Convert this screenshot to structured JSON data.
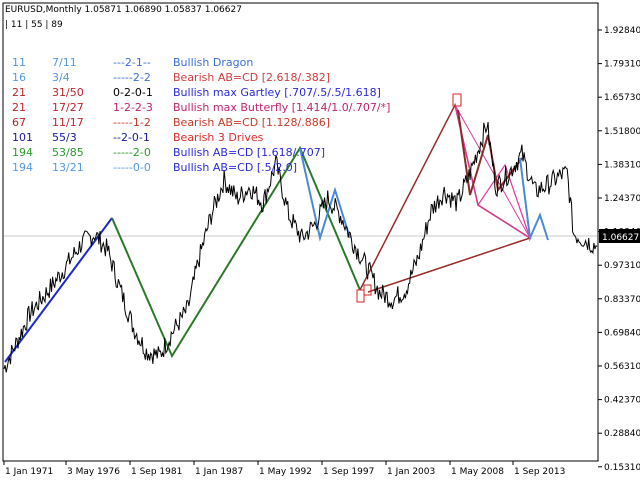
{
  "header": {
    "symbol_line": "EURUSD,Monthly  1.05871 1.06890 1.05837 1.06627",
    "fib_line": "| 11 | 55 | 89"
  },
  "patterns": [
    {
      "period": "11",
      "ratio": "7/11",
      "code": "---2-1--",
      "name": "Bullish Dragon",
      "color": "#3a6fd8"
    },
    {
      "period": "16",
      "ratio": "3/4",
      "code": "-----2-2",
      "name": "Bearish AB=CD [2.618/.382]",
      "color": "#d23c3c"
    },
    {
      "period": "21",
      "ratio": "31/50",
      "code": "0-2-0-1",
      "name": "Bullish max Gartley [.707/.5/.5/1.618]",
      "color": "#2a2adc"
    },
    {
      "period": "21",
      "ratio": "17/27",
      "code": "1-2-2-3",
      "name": "Bullish max Butterfly [1.414/1.0/.707/*]",
      "color": "#c0226e"
    },
    {
      "period": "67",
      "ratio": "11/17",
      "code": "-----1-2",
      "name": "Bearish AB=CD [1.128/.886]",
      "color": "#c83a2a"
    },
    {
      "period": "101",
      "ratio": "55/3",
      "code": "--2-0-1",
      "name": "Bearish 3 Drives",
      "color": "#e02a2a"
    },
    {
      "period": "194",
      "ratio": "53/85",
      "code": "-----2-0",
      "name": "Bullish AB=CD [1.618/.707]",
      "color": "#2a2adc"
    },
    {
      "period": "194",
      "ratio": "13/21",
      "code": "-----0-0",
      "name": "Bullish AB=CD [.5/2.0]",
      "color": "#2a2adc"
    }
  ],
  "period_colors": [
    "#5599dd",
    "#5599dd",
    "#c0222a",
    "#c0222a",
    "#c0222a",
    "#1a1a9a",
    "#2a9a2a",
    "#5599dd"
  ],
  "ratio_colors": [
    "#5599dd",
    "#5599dd",
    "#c0222a",
    "#c0222a",
    "#c0222a",
    "#1a1a9a",
    "#2a9a2a",
    "#5599dd"
  ],
  "code_colors": [
    "#3a6fd8",
    "#3a6fd8",
    "#000000",
    "#c0226e",
    "#c83a2a",
    "#1a1a9a",
    "#2a9a2a",
    "#5599dd"
  ],
  "chart_data": {
    "type": "line",
    "symbol": "EURUSD",
    "timeframe": "Monthly",
    "current_price": "1.06627",
    "ylim": [
      0.156,
      2.1
    ],
    "y_ticks": [
      "1.92840",
      "1.79310",
      "1.65730",
      "1.51800",
      "1.38310",
      "1.24370",
      "1.10840",
      "0.97310",
      "0.83370",
      "0.69840",
      "0.56310",
      "0.42370",
      "0.28840",
      "0.15310"
    ],
    "x_ticks": [
      "1 Jan 1971",
      "3 May 1976",
      "1 Sep 1981",
      "1 Jan 1987",
      "1 May 1992",
      "1 Sep 1997",
      "1 Jan 2003",
      "1 May 2008",
      "1 Sep 2013"
    ],
    "x_range": [
      1971.0,
      2016.8
    ],
    "series": [
      {
        "x": [
          1971.0,
          1972.0,
          1973.0,
          1974.0,
          1975.0,
          1976.0,
          1977.0,
          1978.0,
          1979.0,
          1980.0,
          1981.0,
          1982.0,
          1983.0,
          1984.0,
          1985.2,
          1986.0,
          1987.0,
          1988.0,
          1989.0,
          1990.0,
          1991.0,
          1992.0,
          1993.0,
          1994.0,
          1995.0,
          1996.0,
          1997.0,
          1998.0,
          1999.0,
          2000.0,
          2001.0,
          2002.0,
          2003.0,
          2004.0,
          2005.0,
          2006.0,
          2007.0,
          2008.3,
          2009.0,
          2010.0,
          2011.0,
          2012.0,
          2013.0,
          2014.0,
          2014.5,
          2015.0,
          2016.0,
          2016.8
        ],
        "y": [
          0.545,
          0.66,
          0.78,
          0.85,
          0.92,
          1.0,
          1.08,
          1.12,
          1.05,
          0.88,
          0.72,
          0.62,
          0.6,
          0.7,
          0.8,
          1.0,
          1.2,
          1.35,
          1.27,
          1.32,
          1.25,
          1.42,
          1.2,
          1.1,
          1.16,
          1.27,
          1.2,
          1.08,
          0.98,
          0.87,
          0.84,
          0.88,
          1.02,
          1.22,
          1.3,
          1.25,
          1.38,
          1.59,
          1.32,
          1.38,
          1.46,
          1.3,
          1.33,
          1.37,
          1.38,
          1.12,
          1.09,
          1.066
        ]
      }
    ]
  }
}
